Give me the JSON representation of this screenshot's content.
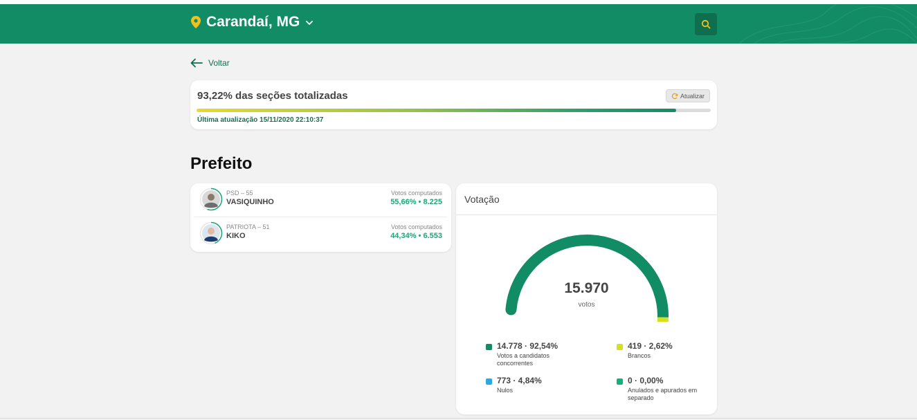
{
  "header": {
    "city": "Carandaí, MG",
    "colors": {
      "bg": "#128c64",
      "pin": "#f2c21b"
    },
    "icons": {
      "location": "location-pin-icon",
      "dropdown": "chevron-down-icon",
      "search": "search-icon"
    }
  },
  "nav": {
    "back_label": "Voltar"
  },
  "progress": {
    "title": "93,22% das seções totalizadas",
    "fraction": 0.9322,
    "refresh_label": "Atualizar",
    "updated": "Última atualização 15/11/2020 22:10:37"
  },
  "section": {
    "title": "Prefeito"
  },
  "candidates": [
    {
      "party": "PSD – 55",
      "name": "VASIQUINHO",
      "votes_label": "Votos computados",
      "votes": "55,66%  •  8.225",
      "share": 0.5566
    },
    {
      "party": "PATRIOTA – 51",
      "name": "KIKO",
      "votes_label": "Votos computados",
      "votes": "44,34%  •  6.553",
      "share": 0.4434
    }
  ],
  "voting": {
    "title": "Votação",
    "total": "15.970",
    "unit": "votos",
    "legend": [
      {
        "value": "14.778 · 92,54%",
        "label": "Votos a candidatos concorrentes",
        "color": "#128c64",
        "fraction": 0.9254
      },
      {
        "value": "419 · 2,62%",
        "label": "Brancos",
        "color": "#d4e21b",
        "fraction": 0.0262
      },
      {
        "value": "773 · 4,84%",
        "label": "Nulos",
        "color": "#2aa8e0",
        "fraction": 0.0484
      },
      {
        "value": "0 · 0,00%",
        "label": "Anulados e apurados em separado",
        "color": "#14b07c",
        "fraction": 0.0
      }
    ]
  }
}
